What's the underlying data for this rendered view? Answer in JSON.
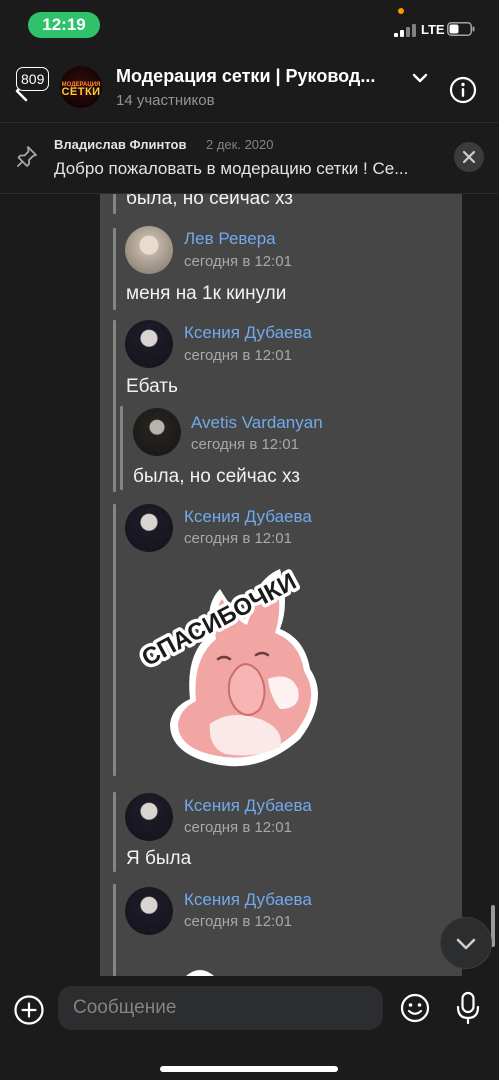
{
  "status_bar": {
    "time": "12:19",
    "network": "LTE"
  },
  "header": {
    "unread_count": "809",
    "chat_title": "Модерация сетки | Руковод...",
    "chat_subtitle": "14 участников",
    "avatar_text_top": "МОДЕРАЦИЯ",
    "avatar_text_bottom": "СЕТКИ"
  },
  "pinned": {
    "author": "Владислав Флинтов",
    "date": "2 дек. 2020",
    "text": "Добро пожаловать в модерацию сетки ! Се..."
  },
  "messages": {
    "top_text": "была, но сейчас хз",
    "m1": {
      "name": "Лев Ревера",
      "time": "сегодня в 12:01",
      "text": "меня на 1к кинули"
    },
    "m2": {
      "name": "Ксения Дубаева",
      "time": "сегодня в 12:01",
      "text": "Ебать"
    },
    "m2_fwd": {
      "name": "Avetis Vardanyan",
      "time": "сегодня в 12:01",
      "text": "была, но сейчас хз"
    },
    "m3": {
      "name": "Ксения Дубаева",
      "time": "сегодня в 12:01",
      "sticker_text": "СПАСИБОЧКИ"
    },
    "m4": {
      "name": "Ксения Дубаева",
      "time": "сегодня в 12:01",
      "text": "Я была"
    },
    "m5": {
      "name": "Ксения Дубаева",
      "time": "сегодня в 12:01"
    }
  },
  "composer": {
    "placeholder": "Сообщение"
  },
  "colors": {
    "accent_link": "#71aaeb",
    "status_green": "#2fc26b",
    "bubble_bg": "#464646",
    "app_bg": "#1b1b1c"
  },
  "icons": [
    "back-arrow-icon",
    "chevron-down-icon",
    "info-icon",
    "pin-icon",
    "close-icon",
    "chevron-down-icon",
    "add-icon",
    "emoji-icon",
    "mic-icon"
  ]
}
